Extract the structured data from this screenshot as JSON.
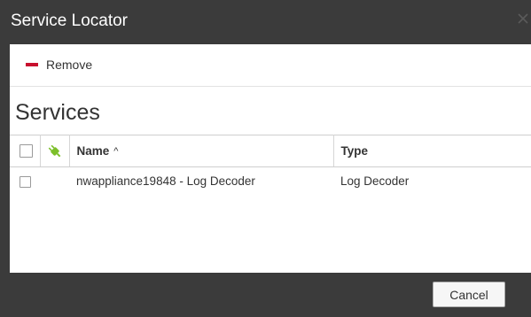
{
  "dialog": {
    "title": "Service Locator"
  },
  "toolbar": {
    "remove_label": "Remove"
  },
  "section": {
    "title": "Services"
  },
  "table": {
    "columns": {
      "name": "Name",
      "type": "Type"
    },
    "sort_indicator": "^",
    "rows": [
      {
        "name": "nwappliance19848 - Log Decoder",
        "type": "Log Decoder"
      }
    ]
  },
  "footer": {
    "cancel_label": "Cancel"
  },
  "colors": {
    "chrome": "#3b3b3b",
    "remove_icon": "#c8102e",
    "connection_icon": "#7cbf2a"
  }
}
